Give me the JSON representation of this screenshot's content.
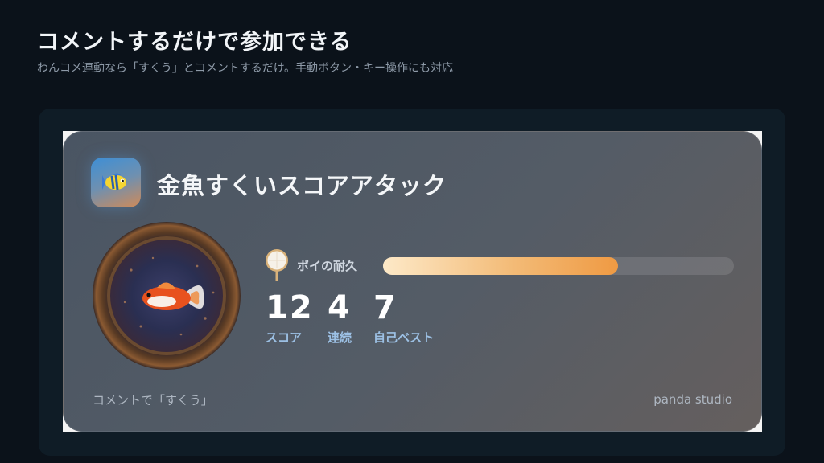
{
  "page": {
    "heading": "コメントするだけで参加できる",
    "subheading": "わんコメ連動なら「すくう」とコメントするだけ。手動ボタン・キー操作にも対応"
  },
  "card": {
    "app_icon": "fish-icon",
    "title": "金魚すくいスコアアタック",
    "bowl_image": "goldfish-bowl-icon",
    "durability": {
      "icon": "poi-icon",
      "label": "ポイの耐久",
      "fraction": 0.67
    },
    "stats": [
      {
        "value": "12",
        "label": "スコア"
      },
      {
        "value": "4",
        "label": "連続"
      },
      {
        "value": "7",
        "label": "自己ベスト"
      }
    ],
    "footer_hint": "コメントで「すくう」",
    "footer_brand": "panda studio"
  },
  "colors": {
    "background": "#0b121a",
    "accent_orange": "#ef9a43",
    "label_blue": "#9cc0e4"
  }
}
